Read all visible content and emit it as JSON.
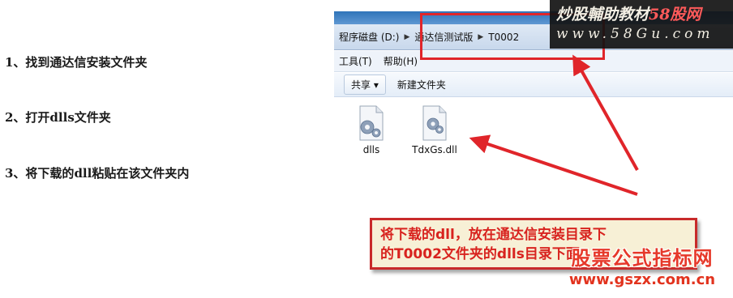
{
  "instructions": {
    "step1": "1、找到通达信安装文件夹",
    "step2": "2、打开dlls文件夹",
    "step3": "3、将下载的dll粘贴在该文件夹内"
  },
  "explorer": {
    "breadcrumb": [
      "程序磁盘 (D:)",
      "通达信测试版",
      "T0002"
    ],
    "menu": [
      "工具(T)",
      "帮助(H)"
    ],
    "toolbar": {
      "share_label": "共享 ▾",
      "new_folder_label": "新建文件夹"
    },
    "files": [
      {
        "name": "dlls",
        "icon": "settings-file-icon"
      },
      {
        "name": "TdxGs.dll",
        "icon": "dll-file-icon"
      }
    ]
  },
  "watermark_top": {
    "line1_main": "炒股輔助教材",
    "line1_accent": "58股网",
    "line2": "www.58Gu.com"
  },
  "callout": {
    "line1": "将下载的dll，放在通达信安装目录下",
    "line2": "的T0002文件夹的dlls目录下面"
  },
  "watermark_bottom": {
    "line1": "股票公式指标网",
    "line2": "www.gszx.com.cn"
  },
  "colors": {
    "annotation_red": "#e0252a",
    "callout_bg": "#f7f0d6",
    "callout_text": "#d8231f",
    "explorer_title": "#2f74b9"
  }
}
